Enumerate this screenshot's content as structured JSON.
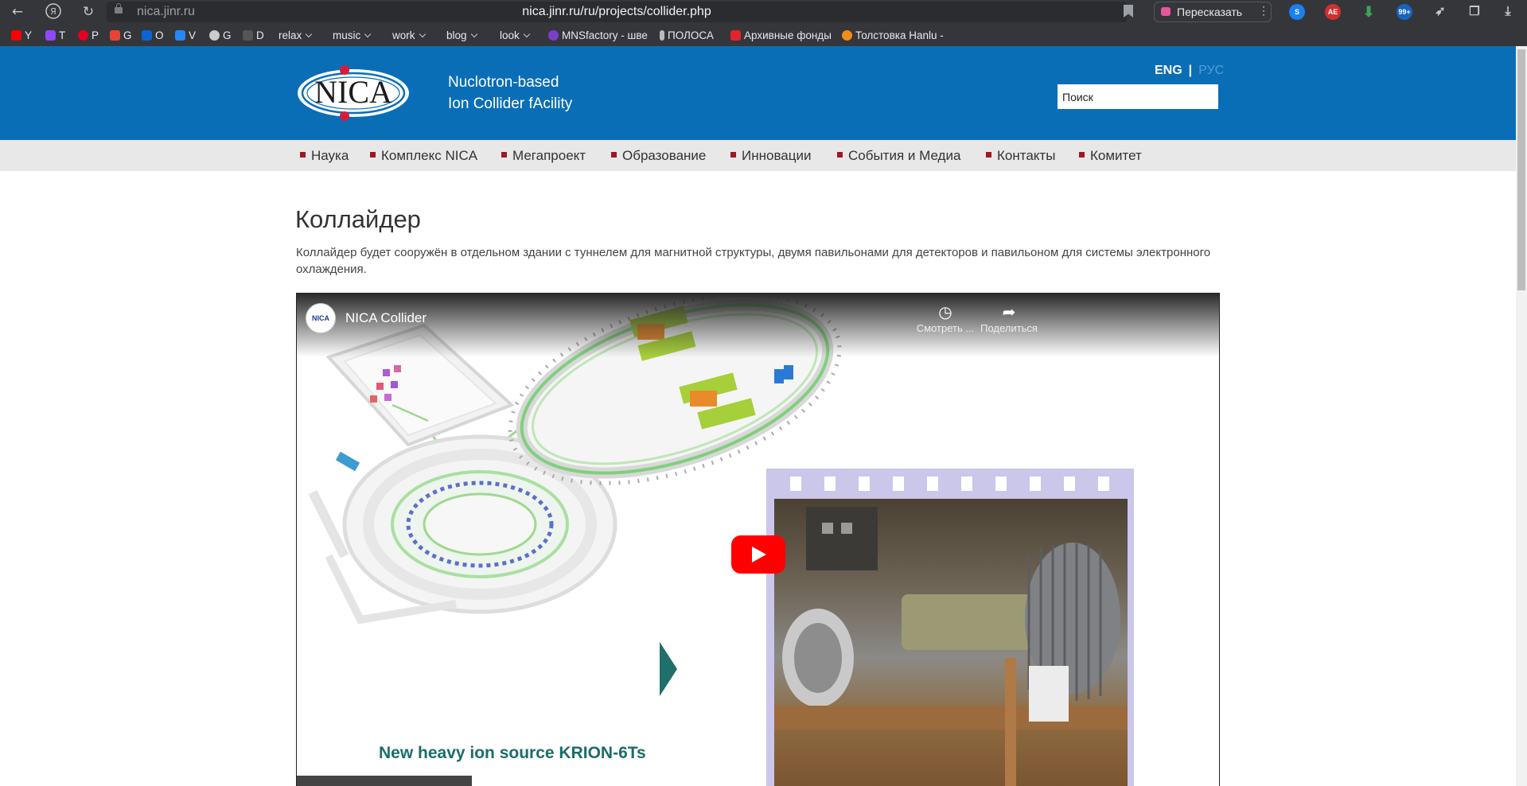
{
  "browser": {
    "address_domain": "nica.jinr.ru",
    "address_url": "nica.jinr.ru/ru/projects/collider.php",
    "retell_label": "Пересказать",
    "nav_icons": [
      "back-icon",
      "yandex-icon",
      "reload-icon"
    ],
    "extension_badges": [
      "AE",
      "99+"
    ],
    "bookmarks": [
      {
        "label": "Y",
        "icon": "youtube-icon",
        "color": "#ff0000"
      },
      {
        "label": "T",
        "icon": "twitch-icon",
        "color": "#9146ff"
      },
      {
        "label": "P",
        "icon": "pinterest-icon",
        "color": "#e60023"
      },
      {
        "label": "G",
        "icon": "gmail-icon",
        "color": "#ea4335"
      },
      {
        "label": "O",
        "icon": "outlook-icon",
        "color": "#0a64d6"
      },
      {
        "label": "V",
        "icon": "vk-icon",
        "color": "#2787f5"
      },
      {
        "label": "G",
        "icon": "chatgpt-icon",
        "color": "#cccccc"
      },
      {
        "label": "D",
        "icon": "d-icon",
        "color": "#555555"
      },
      {
        "label": "relax",
        "folder": true
      },
      {
        "label": "music",
        "folder": true
      },
      {
        "label": "work",
        "folder": true
      },
      {
        "label": "blog",
        "folder": true
      },
      {
        "label": "look",
        "folder": true
      },
      {
        "label": "MNSfactory - шве",
        "icon": "mns-icon",
        "color": "#7b3fc9"
      },
      {
        "label": "ПОЛОСА",
        "icon": "polosa-icon",
        "color": "#bbbbbb"
      },
      {
        "label": "Архивные фонды",
        "icon": "archive-icon",
        "color": "#e3242b"
      },
      {
        "label": "Толстовка Hanlu -",
        "icon": "fire-icon",
        "color": "#f28c1a"
      }
    ]
  },
  "header": {
    "logo_text": "NICA",
    "tagline_line1": "Nuclotron-based",
    "tagline_line2": "Ion Collider fAcility",
    "lang_eng": "ENG",
    "lang_sep": "|",
    "lang_rus": "РУС",
    "search_placeholder": "Поиск"
  },
  "nav": {
    "items": [
      "Наука",
      "Комплекс NICA",
      "Мегапроект",
      "Образование",
      "Инновации",
      "События и Медиа",
      "Контакты",
      "Комитет"
    ],
    "bullet_color": "#a3161f"
  },
  "content": {
    "title": "Коллайдер",
    "intro": "Коллайдер будет сооружён в отдельном здании с туннелем для магнитной структуры, двумя павильонами для детекторов и павильоном для системы электронного охлаждения."
  },
  "video": {
    "channel_avatar_text": "NICA",
    "title": "NICA Collider",
    "watch_later": "Смотреть ...",
    "share": "Поделиться",
    "overlay_caption": "New heavy ion source KRION-6Ts"
  },
  "colors": {
    "brand_blue": "#0a6eb7",
    "nav_bg": "#e8e8e8",
    "play_red": "#ff0000",
    "browser_bg": "#35363a"
  }
}
